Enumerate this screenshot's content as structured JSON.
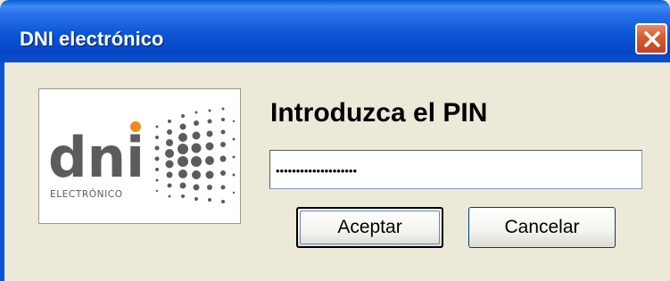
{
  "window": {
    "title": "DNI electrónico",
    "close_icon": "close-x-icon"
  },
  "logo": {
    "brand": "dni",
    "subtitle": "ELECTRÓNICO",
    "icon": "dni-dots-logo",
    "accent_color": "#f08a1e",
    "text_color": "#5a5c5e"
  },
  "dialog": {
    "heading": "Introduzca el PIN",
    "pin_value": "••••••••••••••••••••"
  },
  "buttons": {
    "accept_label": "Aceptar",
    "cancel_label": "Cancelar"
  }
}
